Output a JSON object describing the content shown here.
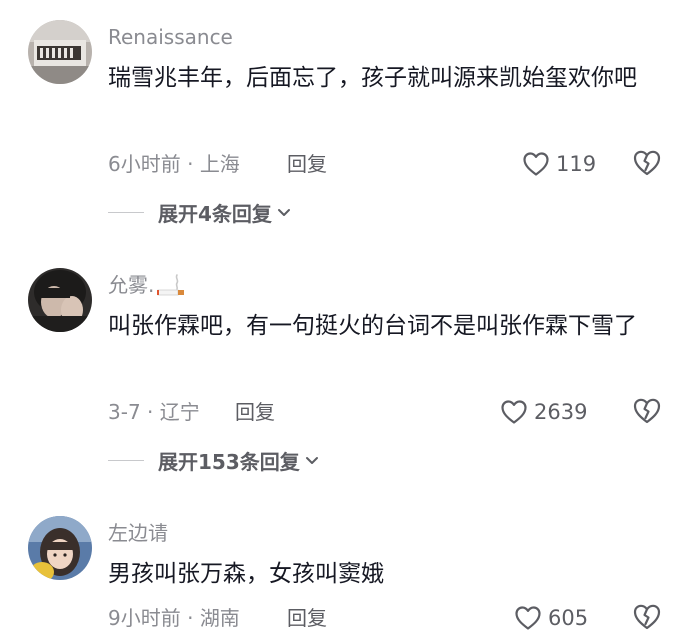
{
  "comments": [
    {
      "username": "Renaissance",
      "text": "瑞雪兆丰年，后面忘了，孩子就叫源来凯始玺欢你吧",
      "time": "6小时前",
      "location": "上海",
      "reply_label": "回复",
      "likes": "119",
      "expand_label": "展开4条回复"
    },
    {
      "username": "允雾.",
      "text": "叫张作霖吧，有一句挺火的台词不是叫张作霖下雪了",
      "time": "3-7",
      "location": "辽宁",
      "reply_label": "回复",
      "likes": "2639",
      "expand_label": "展开153条回复"
    },
    {
      "username": "左边请",
      "text": "男孩叫张万森，女孩叫窦娥",
      "time": "9小时前",
      "location": "湖南",
      "reply_label": "回复",
      "likes": "605"
    }
  ],
  "meta_separator": "·",
  "icons": {
    "like": "heart-outline-icon",
    "dislike": "broken-heart-icon",
    "expand": "chevron-down-icon",
    "badge": "cigarette-emoji-icon"
  },
  "colors": {
    "text_primary": "#161823",
    "text_secondary": "#8a8b91",
    "text_action": "#5c5d63",
    "divider": "#c8c9cc"
  }
}
